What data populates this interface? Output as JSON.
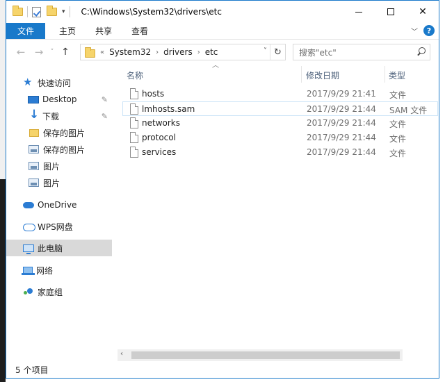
{
  "window": {
    "title": "C:\\Windows\\System32\\drivers\\etc",
    "controls": {
      "minimize": "—",
      "maximize": "☐",
      "close": "✕"
    }
  },
  "ribbon": {
    "tabs": [
      {
        "label": "文件",
        "active": true
      },
      {
        "label": "主页"
      },
      {
        "label": "共享"
      },
      {
        "label": "查看"
      }
    ],
    "help_label": "?"
  },
  "address": {
    "overflow": "«",
    "crumbs": [
      "System32",
      "drivers",
      "etc"
    ],
    "search_placeholder": "搜索\"etc\""
  },
  "nav_pane": {
    "items": [
      {
        "label": "快速访问",
        "icon": "star-icon"
      },
      {
        "label": "Desktop",
        "icon": "desktop-icon",
        "pinned": true
      },
      {
        "label": "下载",
        "icon": "download-icon",
        "pinned": true
      },
      {
        "label": "保存的图片",
        "icon": "folder-icon"
      },
      {
        "label": "保存的图片",
        "icon": "picture-icon"
      },
      {
        "label": "图片",
        "icon": "picture-icon"
      },
      {
        "label": "图片",
        "icon": "picture-icon"
      },
      {
        "label": "OneDrive",
        "icon": "onedrive-icon"
      },
      {
        "label": "WPS网盘",
        "icon": "wps-cloud-icon"
      },
      {
        "label": "此电脑",
        "icon": "pc-icon",
        "selected": true
      },
      {
        "label": "网络",
        "icon": "network-icon"
      },
      {
        "label": "家庭组",
        "icon": "homegroup-icon"
      }
    ]
  },
  "files": {
    "columns": {
      "name": "名称",
      "date": "修改日期",
      "type": "类型"
    },
    "rows": [
      {
        "name": "hosts",
        "date": "2017/9/29 21:41",
        "type": "文件"
      },
      {
        "name": "lmhosts.sam",
        "date": "2017/9/29 21:44",
        "type": "SAM 文件"
      },
      {
        "name": "networks",
        "date": "2017/9/29 21:44",
        "type": "文件"
      },
      {
        "name": "protocol",
        "date": "2017/9/29 21:44",
        "type": "文件"
      },
      {
        "name": "services",
        "date": "2017/9/29 21:44",
        "type": "文件"
      }
    ]
  },
  "status": {
    "item_count": "5 个项目"
  },
  "colors": {
    "accent": "#1979ca",
    "header_text": "#4c607a",
    "selected_bg": "#d9d9d9"
  }
}
